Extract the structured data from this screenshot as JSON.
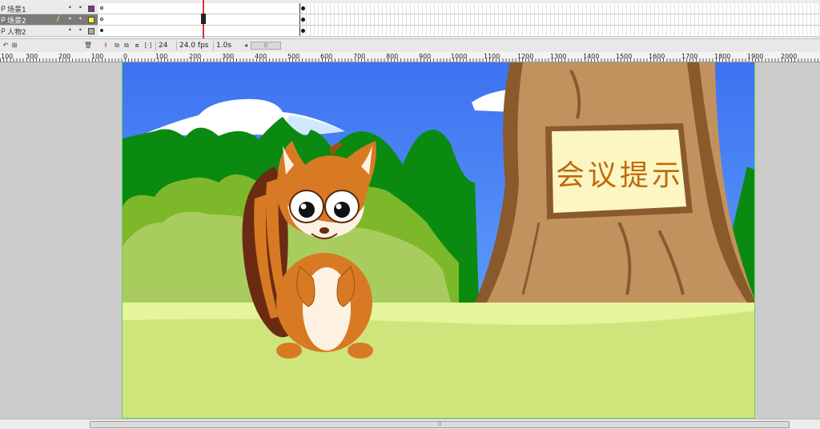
{
  "timeline": {
    "layers": [
      {
        "name": "场景1",
        "swatch": "#8e2c8e",
        "selected": false
      },
      {
        "name": "场景2",
        "swatch": "#ffff33",
        "selected": true
      },
      {
        "name": "人物2",
        "swatch": "#aaaaaa",
        "selected": false
      }
    ],
    "current_frame": "24",
    "fps": "24.0 fps",
    "elapsed": "1.0s",
    "scroll_grip": "⦙⦙⦙"
  },
  "ruler": {
    "labels": [
      "100",
      "300",
      "200",
      "100",
      "0",
      "100",
      "200",
      "300",
      "400",
      "500",
      "600",
      "700",
      "800",
      "900",
      "1000",
      "1100",
      "1200",
      "1300",
      "1400",
      "1500",
      "1600",
      "1700",
      "1800",
      "1900",
      "2000"
    ]
  },
  "stage": {
    "sign_text": "会议提示"
  },
  "scrollbar": {
    "grip": "⦙⦙⦙"
  }
}
